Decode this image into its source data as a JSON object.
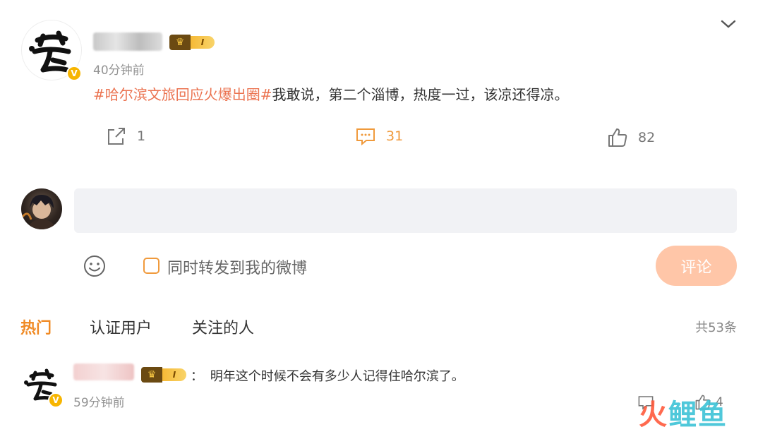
{
  "post": {
    "time": "40分钟前",
    "vip_level": "I",
    "hashtag": "#哈尔滨文旅回应火爆出圈#",
    "text": "我敢说，第二个淄博，热度一过，该凉还得凉。",
    "actions": {
      "forward_count": "1",
      "comment_count": "31",
      "like_count": "82"
    }
  },
  "composer": {
    "placeholder": "",
    "forward_label": "同时转发到我的微博",
    "submit_label": "评论"
  },
  "tabs": [
    {
      "label": "热门"
    },
    {
      "label": "认证用户"
    },
    {
      "label": "关注的人"
    }
  ],
  "total_label": "共53条",
  "comments": [
    {
      "vip_level": "I",
      "separator": "：",
      "text": "明年这个时候不会有多少人记得住哈尔滨了。",
      "time": "59分钟前",
      "like_count": "4"
    }
  ],
  "colors": {
    "accent": "#f09a3c",
    "hashtag": "#eb7350",
    "submit_disabled": "#ffc6a8"
  },
  "watermark": {
    "part1": "火",
    "part2": "鲤鱼"
  }
}
